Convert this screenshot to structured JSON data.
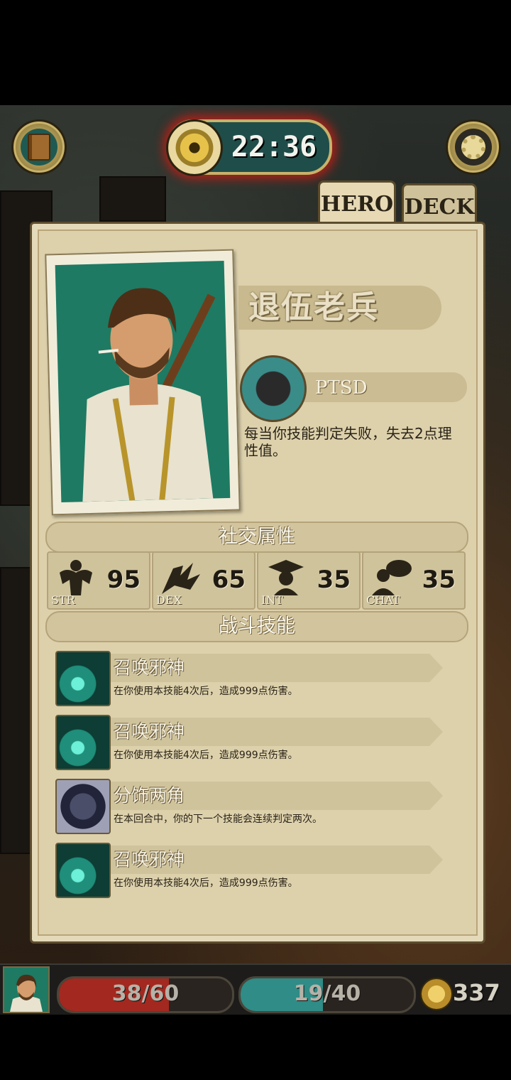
{
  "header": {
    "timer": "22:36"
  },
  "tabs": [
    {
      "label": "HERO"
    },
    {
      "label": "DECK"
    }
  ],
  "hero": {
    "name": "退伍老兵",
    "trait": {
      "name": "PTSD",
      "description": "每当你技能判定失败，失去2点理性值。"
    }
  },
  "attributes": {
    "title": "社交属性",
    "stats": [
      {
        "label": "STR",
        "value": "95"
      },
      {
        "label": "DEX",
        "value": "65"
      },
      {
        "label": "INT",
        "value": "35"
      },
      {
        "label": "CHAT",
        "value": "35"
      }
    ]
  },
  "skills": {
    "title": "战斗技能",
    "items": [
      {
        "name": "召唤邪神",
        "description": "在你使用本技能4次后，造成999点伤害。",
        "icon": "summon-evil-god-icon"
      },
      {
        "name": "召唤邪神",
        "description": "在你使用本技能4次后，造成999点伤害。",
        "icon": "summon-evil-god-icon"
      },
      {
        "name": "分饰两角",
        "description": "在本回合中，你的下一个技能会连续判定两次。",
        "icon": "dual-role-icon"
      },
      {
        "name": "召唤邪神",
        "description": "在你使用本技能4次后，造成999点伤害。",
        "icon": "summon-evil-god-icon"
      }
    ]
  },
  "status": {
    "health": {
      "text": "38/60",
      "fraction": 0.6333,
      "color": "#a3281f"
    },
    "sanity": {
      "text": "19/40",
      "fraction": 0.475,
      "color": "#2f8c86"
    },
    "coins": "337"
  },
  "colors": {
    "parchment": "#ddd1ac",
    "accent_teal": "#1f5a52",
    "gold": "#c7b26a",
    "timer_glow": "#c81e14"
  }
}
